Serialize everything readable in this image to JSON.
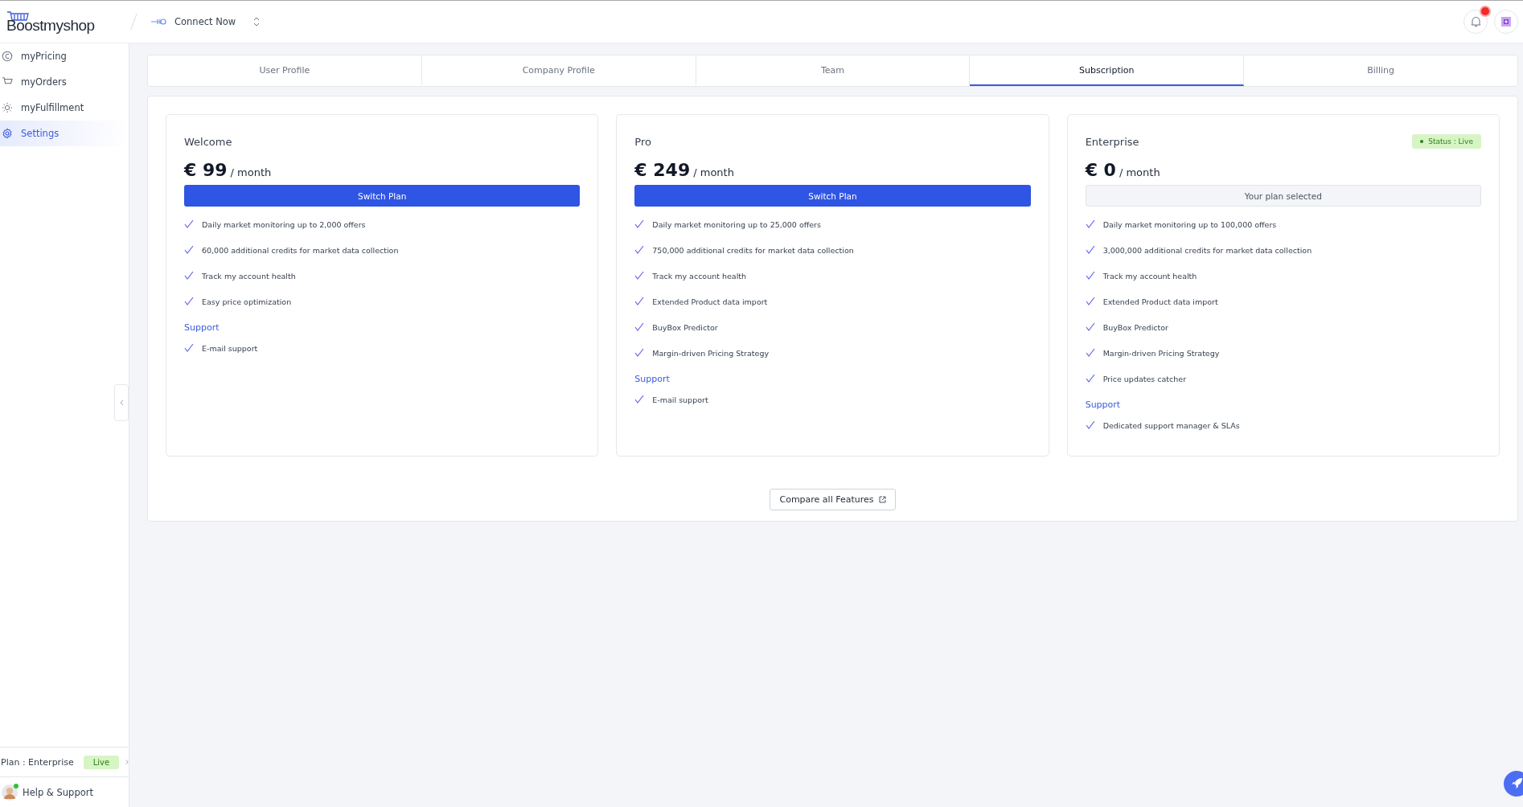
{
  "header": {
    "logo": "Boostmyshop",
    "connection": "Connect Now",
    "notification": true
  },
  "sidebar": {
    "items": [
      {
        "label": "myPricing",
        "selected": false
      },
      {
        "label": "myOrders",
        "selected": false
      },
      {
        "label": "myFulfillment",
        "selected": false
      },
      {
        "label": "Settings",
        "selected": true
      }
    ],
    "plan": {
      "label": "Plan : Enterprise",
      "badge": "Live"
    },
    "help": "Help & Support"
  },
  "tabs": [
    {
      "label": "User Profile",
      "selected": false
    },
    {
      "label": "Company Profile",
      "selected": false
    },
    {
      "label": "Team",
      "selected": false
    },
    {
      "label": "Subscription",
      "selected": true
    },
    {
      "label": "Billing",
      "selected": false
    }
  ],
  "plans": [
    {
      "name": "Welcome",
      "price": "€ 99",
      "period": "/ month",
      "button": {
        "kind": "switch",
        "label": "Switch Plan"
      },
      "features": [
        "Daily market monitoring up to 2,000 offers",
        "60,000 additional credits for market data collection",
        "Track my account health",
        "Easy price optimization"
      ],
      "support_title": "Support",
      "support": [
        "E-mail support"
      ]
    },
    {
      "name": "Pro",
      "price": "€ 249",
      "period": "/ month",
      "button": {
        "kind": "switch",
        "label": "Switch Plan"
      },
      "features": [
        "Daily market monitoring up to 25,000 offers",
        "750,000 additional credits for market data collection",
        "Track my account health",
        "Extended Product data import",
        "BuyBox Predictor",
        "Margin-driven Pricing Strategy"
      ],
      "support_title": "Support",
      "support": [
        "E-mail support"
      ]
    },
    {
      "name": "Enterprise",
      "status": "Status : Live",
      "price": "€ 0",
      "period": "/ month",
      "button": {
        "kind": "current",
        "label": "Your plan selected"
      },
      "features": [
        "Daily market monitoring up to 100,000 offers",
        "3,000,000 additional credits for market data collection",
        "Track my account health",
        "Extended Product data import",
        "BuyBox Predictor",
        "Margin-driven Pricing Strategy",
        "Price updates catcher"
      ],
      "support_title": "Support",
      "support": [
        "Dedicated support manager & SLAs"
      ]
    }
  ],
  "compare_button": "Compare all Features"
}
